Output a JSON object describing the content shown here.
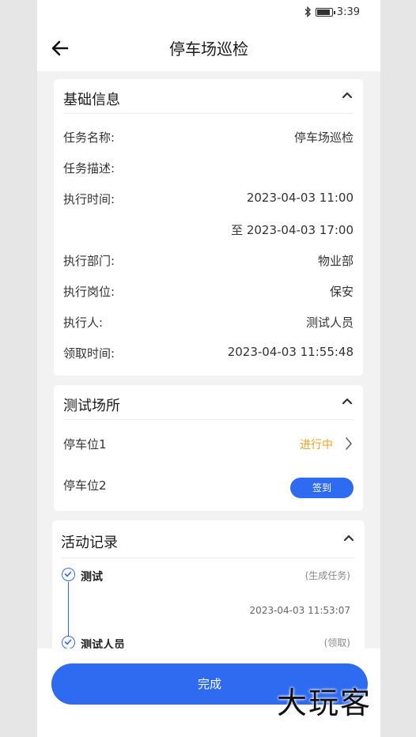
{
  "status_bar": {
    "time": "3:39",
    "bluetooth_icon": "bluetooth-icon",
    "battery_icon": "battery-icon"
  },
  "header": {
    "title": "停车场巡检",
    "back_icon": "arrow-left-icon"
  },
  "basic_info": {
    "title": "基础信息",
    "rows": [
      {
        "label": "任务名称:",
        "value": "停车场巡检"
      },
      {
        "label": "任务描述:",
        "value": ""
      },
      {
        "label": "执行时间:",
        "value": "2023-04-03 11:00"
      },
      {
        "label": "",
        "value": "至 2023-04-03 17:00"
      },
      {
        "label": "执行部门:",
        "value": "物业部"
      },
      {
        "label": "执行岗位:",
        "value": "保安"
      },
      {
        "label": "执行人:",
        "value": "测试人员"
      },
      {
        "label": "领取时间:",
        "value": "2023-04-03 11:55:48"
      }
    ]
  },
  "places": {
    "title": "测试场所",
    "items": [
      {
        "name": "停车位1",
        "status": "进行中"
      },
      {
        "name": "停车位2",
        "action": "签到"
      }
    ]
  },
  "activity": {
    "title": "活动记录",
    "records": [
      {
        "name": "测试",
        "tag": "(生成任务)",
        "time": "2023-04-03 11:53:07"
      },
      {
        "name": "测试人员",
        "tag": "(领取)"
      }
    ]
  },
  "footer": {
    "done_label": "完成"
  },
  "watermark": "大玩客",
  "colors": {
    "accent": "#2f6bf0",
    "in_progress": "#f0a020"
  }
}
